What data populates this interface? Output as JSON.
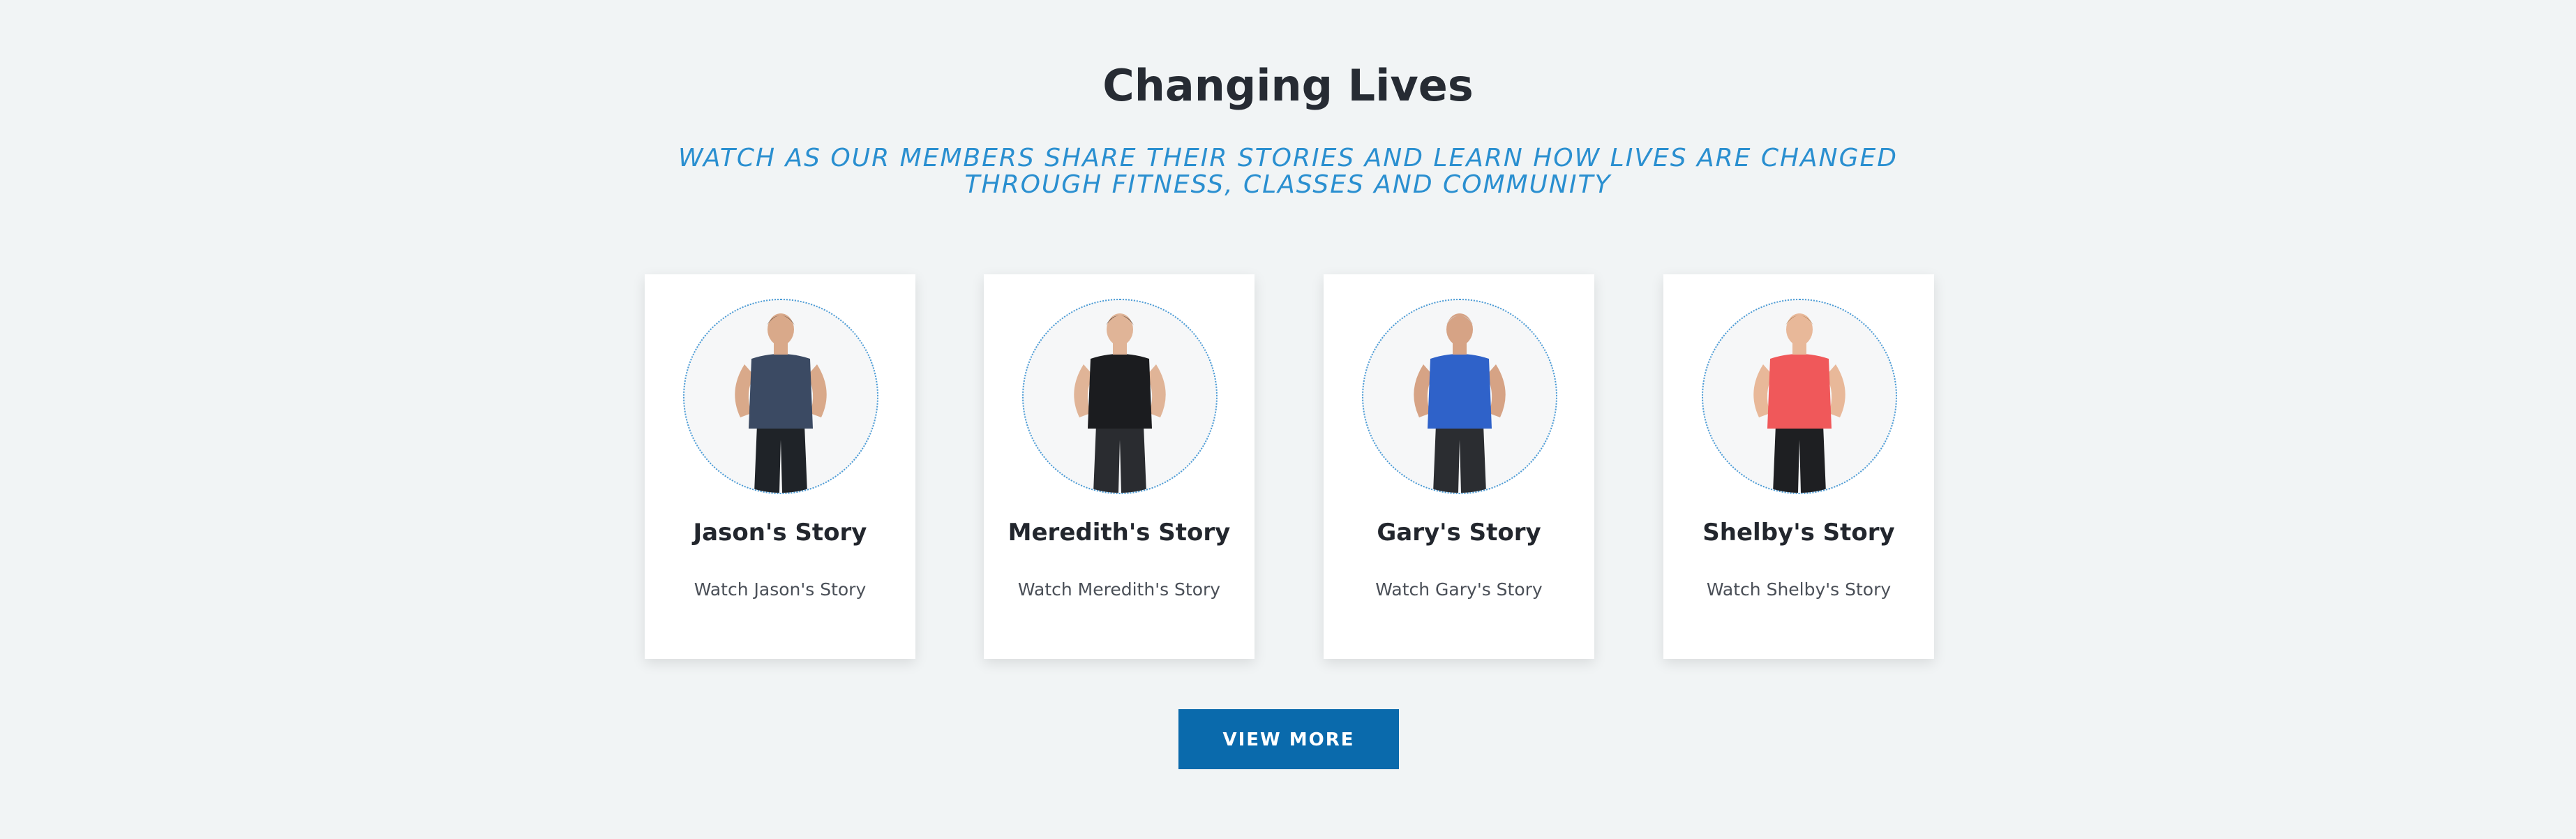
{
  "section": {
    "title": "Changing Lives",
    "subtitle": "WATCH AS OUR MEMBERS SHARE THEIR STORIES AND LEARN HOW LIVES ARE CHANGED THROUGH FITNESS, CLASSES AND COMMUNITY"
  },
  "stories": [
    {
      "name": "Jason's Story",
      "link": "Watch Jason's Story",
      "shirt_color": "#3b4a63",
      "pants_color": "#1f2328",
      "hair_color": "#5a4a3e",
      "skin_color": "#d9a98a"
    },
    {
      "name": "Meredith's Story",
      "link": "Watch Meredith's Story",
      "shirt_color": "#1b1c1f",
      "pants_color": "#2a2c30",
      "hair_color": "#2b211b",
      "skin_color": "#e0b497"
    },
    {
      "name": "Gary's Story",
      "link": "Watch Gary's Story",
      "shirt_color": "#2f62c9",
      "pants_color": "#2b2d31",
      "hair_color": "#cfcfcf",
      "skin_color": "#d6a385"
    },
    {
      "name": "Shelby's Story",
      "link": "Watch Shelby's Story",
      "shirt_color": "#f0585a",
      "pants_color": "#1e1f22",
      "hair_color": "#a47c52",
      "skin_color": "#e8b899"
    }
  ],
  "cta": {
    "label": "VIEW MORE"
  },
  "colors": {
    "background": "#f1f4f5",
    "title": "#262b33",
    "subtitle": "#2a8fd0",
    "button": "#0a6aac",
    "avatar_border": "#4a9bd6"
  },
  "icons": [
    "person-photo-icon"
  ]
}
